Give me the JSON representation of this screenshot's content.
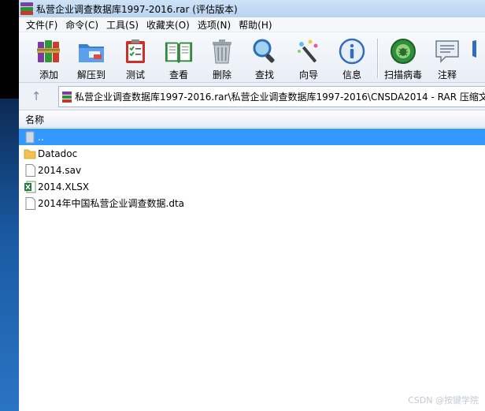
{
  "window": {
    "title": "私营企业调查数据库1997-2016.rar (评估版本)"
  },
  "menu": [
    {
      "label": "文件(F)"
    },
    {
      "label": "命令(C)"
    },
    {
      "label": "工具(S)"
    },
    {
      "label": "收藏夹(O)"
    },
    {
      "label": "选项(N)"
    },
    {
      "label": "帮助(H)"
    }
  ],
  "toolbar": [
    {
      "label": "添加",
      "icon": "books-icon"
    },
    {
      "label": "解压到",
      "icon": "folder-extract-icon"
    },
    {
      "label": "测试",
      "icon": "clipboard-check-icon"
    },
    {
      "label": "查看",
      "icon": "open-book-icon"
    },
    {
      "label": "删除",
      "icon": "trash-icon"
    },
    {
      "label": "查找",
      "icon": "magnifier-icon"
    },
    {
      "label": "向导",
      "icon": "magic-wand-icon"
    },
    {
      "label": "信息",
      "icon": "info-icon"
    },
    {
      "label": "扫描病毒",
      "icon": "virus-scan-icon"
    },
    {
      "label": "注释",
      "icon": "comment-icon"
    }
  ],
  "address": {
    "path": "私营企业调查数据库1997-2016.rar\\私营企业调查数据库1997-2016\\CNSDA2014 - RAR 压缩文"
  },
  "columns": {
    "name": "名称"
  },
  "files": [
    {
      "name": "..",
      "type": "parent",
      "selected": true
    },
    {
      "name": "Datadoc",
      "type": "folder"
    },
    {
      "name": "2014.sav",
      "type": "file"
    },
    {
      "name": "2014.XLSX",
      "type": "excel"
    },
    {
      "name": "2014年中国私营企业调查数据.dta",
      "type": "file"
    }
  ],
  "watermark": "CSDN @按键学院",
  "colors": {
    "selection": "#3399ff",
    "titlebar": "#cfe2f7"
  }
}
